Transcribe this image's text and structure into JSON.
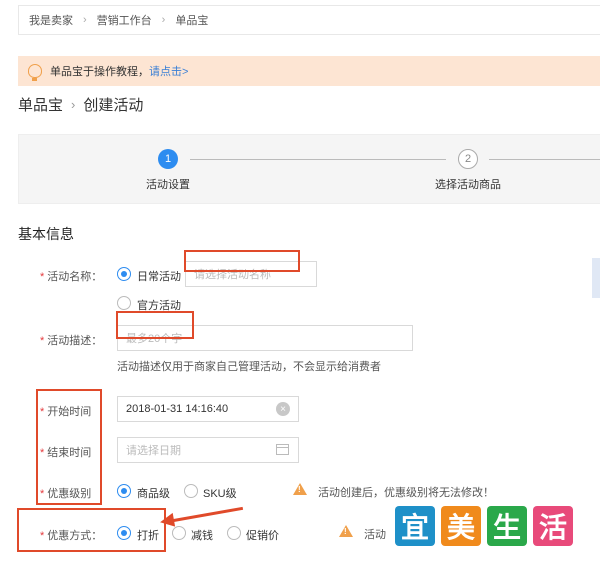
{
  "breadcrumb": {
    "items": [
      "我是卖家",
      "营销工作台",
      "单品宝"
    ]
  },
  "tip": {
    "text": "单品宝于操作教程，",
    "link": "请点击>"
  },
  "page_title": {
    "parent": "单品宝",
    "current": "创建活动"
  },
  "steps": [
    {
      "number": "1",
      "label": "活动设置",
      "active": true
    },
    {
      "number": "2",
      "label": "选择活动商品",
      "active": false
    }
  ],
  "section_title": "基本信息",
  "form": {
    "required_mark": "*",
    "activity_name": {
      "label": "活动名称：",
      "options": [
        "日常活动",
        "官方活动"
      ],
      "selected": "日常活动",
      "placeholder": "请选择活动名称"
    },
    "activity_desc": {
      "label": "活动描述：",
      "placeholder": "最多20个字",
      "hint": "活动描述仅用于商家自己管理活动，不会显示给消费者"
    },
    "start_time": {
      "label": "开始时间",
      "value": "2018-01-31 14:16:40",
      "clear_icon": "close-icon"
    },
    "end_time": {
      "label": "结束时间",
      "placeholder": "请选择日期"
    },
    "discount_level": {
      "label": "优惠级别",
      "options": [
        "商品级",
        "SKU级"
      ],
      "selected": "商品级",
      "warning": "活动创建后，优惠级别将无法修改！"
    },
    "discount_type": {
      "label": "优惠方式：",
      "options": [
        "打折",
        "减钱",
        "促销价"
      ],
      "selected": "打折",
      "warning": "活动"
    }
  },
  "watermark": {
    "chars": [
      "宜",
      "美",
      "生",
      "活"
    ],
    "colors": [
      "#1e90c8",
      "#f08a1c",
      "#2aa84a",
      "#e84a7a"
    ]
  },
  "colors": {
    "accent": "#2d8cf0",
    "annotation": "#e04a2a",
    "tip_bg": "#fde5d3"
  }
}
